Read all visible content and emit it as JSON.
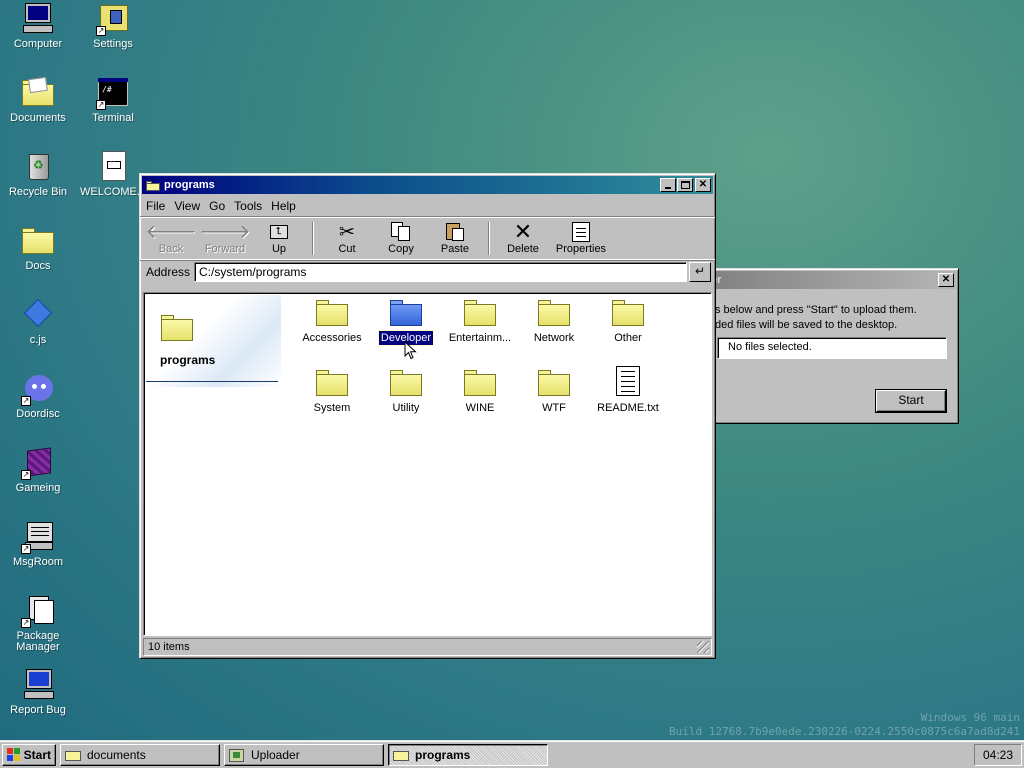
{
  "desktop": {
    "icons": [
      {
        "label": "Computer",
        "icon": "computer-icon"
      },
      {
        "label": "Settings",
        "icon": "settings-icon"
      },
      {
        "label": "Documents",
        "icon": "documents-folder-icon"
      },
      {
        "label": "Terminal",
        "icon": "terminal-icon"
      },
      {
        "label": "Recycle Bin",
        "icon": "recycle-bin-icon"
      },
      {
        "label": "WELCOME...",
        "icon": "welcome-document-icon"
      },
      {
        "label": "Docs",
        "icon": "folder-icon"
      },
      {
        "label": "c.js",
        "icon": "diamond-icon"
      },
      {
        "label": "Doordisc",
        "icon": "discord-icon"
      },
      {
        "label": "Gameing",
        "icon": "cube-icon"
      },
      {
        "label": "MsgRoom",
        "icon": "chat-icon"
      },
      {
        "label": "Package Manager",
        "icon": "package-icon"
      },
      {
        "label": "Report Bug",
        "icon": "monitor-bug-icon"
      }
    ],
    "watermark": {
      "line1": "Windows 96 main",
      "line2": "Build 12768.7b9e0ede.230226-0224.2550c0875c6a7ad8d241"
    }
  },
  "explorer": {
    "title": "programs",
    "menu": [
      "File",
      "View",
      "Go",
      "Tools",
      "Help"
    ],
    "toolbar": {
      "back": "Back",
      "forward": "Forward",
      "up": "Up",
      "cut": "Cut",
      "copy": "Copy",
      "paste": "Paste",
      "delete": "Delete",
      "properties": "Properties"
    },
    "address_label": "Address",
    "address_value": "C:/system/programs",
    "address_go": "↵",
    "side_title": "programs",
    "items": [
      {
        "label": "Accessories",
        "type": "folder"
      },
      {
        "label": "Developer",
        "type": "folder",
        "selected": true
      },
      {
        "label": "Entertainm...",
        "type": "folder"
      },
      {
        "label": "Network",
        "type": "folder"
      },
      {
        "label": "Other",
        "type": "folder"
      },
      {
        "label": "System",
        "type": "folder"
      },
      {
        "label": "Utility",
        "type": "folder"
      },
      {
        "label": "WINE",
        "type": "folder"
      },
      {
        "label": "WTF",
        "type": "folder"
      },
      {
        "label": "README.txt",
        "type": "text-file"
      }
    ],
    "status": "10 items"
  },
  "uploader": {
    "title_fragment": "er",
    "line1": "s below and press \"Start\" to upload them.",
    "line2": "ded files will be saved to the desktop.",
    "file_field": "No files selected.",
    "start_button": "Start"
  },
  "taskbar": {
    "start": "Start",
    "tasks": [
      {
        "label": "documents",
        "active": false
      },
      {
        "label": "Uploader",
        "active": false
      },
      {
        "label": "programs",
        "active": true
      }
    ],
    "clock": "04:23"
  }
}
